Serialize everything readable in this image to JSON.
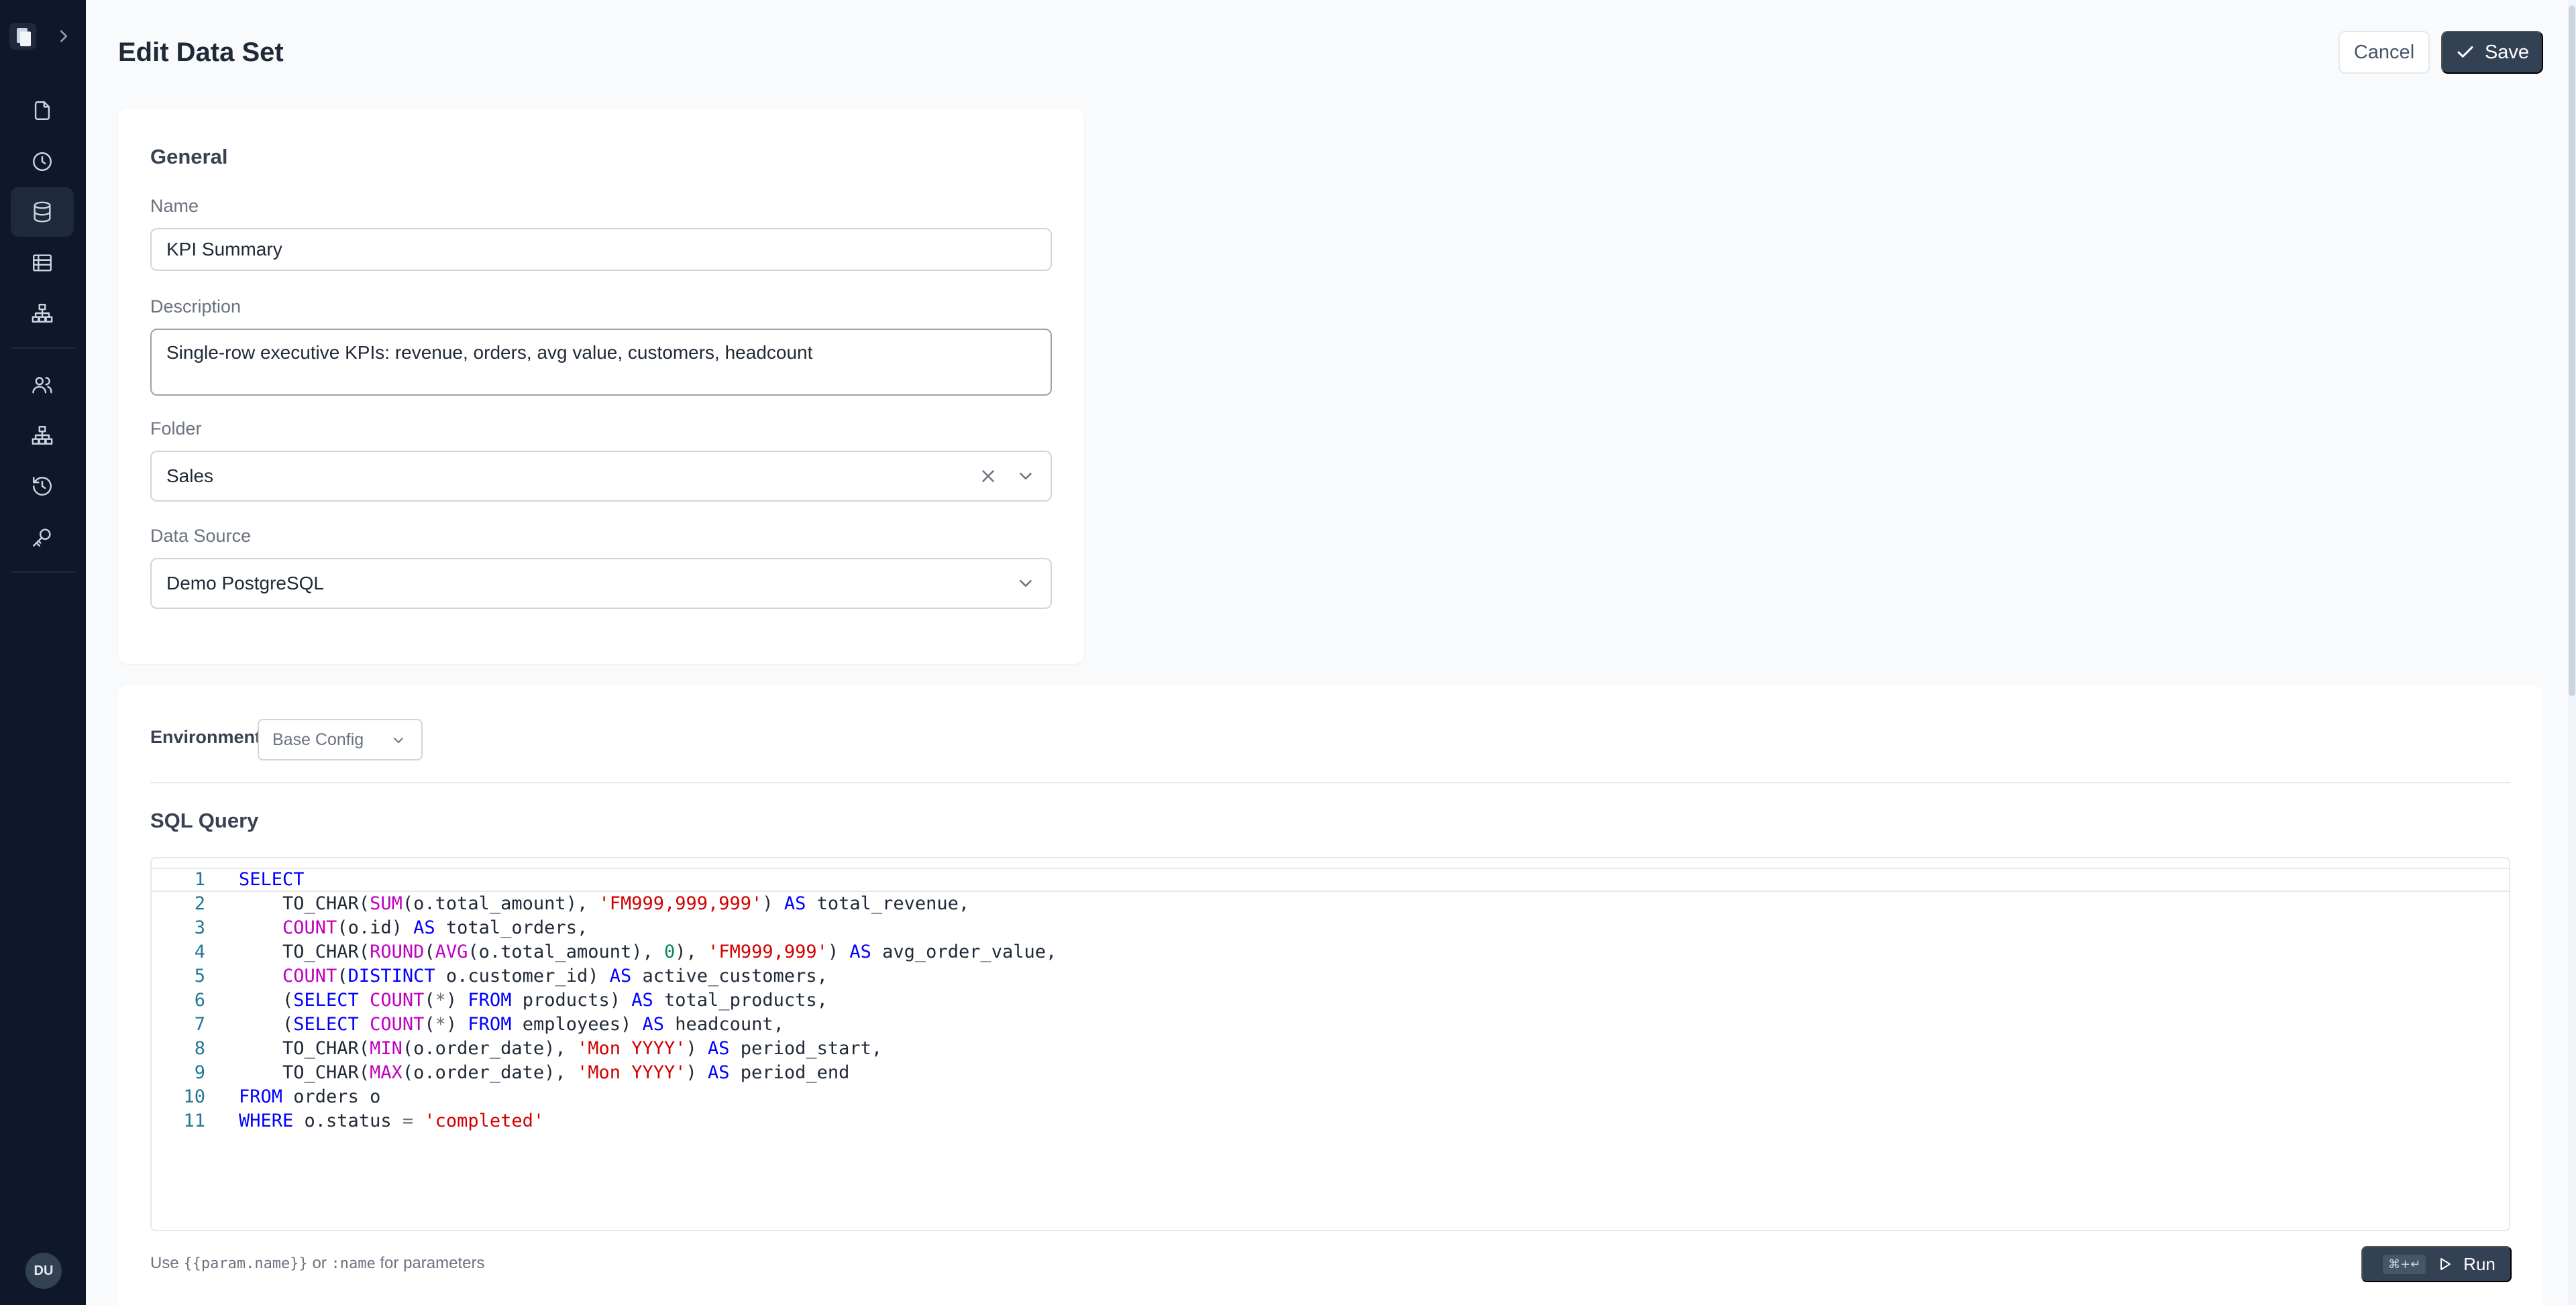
{
  "sidebar": {
    "nav_items": [
      {
        "name": "documents",
        "icon": "file-icon",
        "active": false
      },
      {
        "name": "history",
        "icon": "clock-icon",
        "active": false
      },
      {
        "name": "data-sets",
        "icon": "database-icon",
        "active": true
      },
      {
        "name": "tables",
        "icon": "table-icon",
        "active": false
      },
      {
        "name": "hierarchy",
        "icon": "sitemap-icon",
        "active": false
      },
      {
        "name": "users",
        "icon": "users-icon",
        "active": false
      },
      {
        "name": "org",
        "icon": "sitemap-icon",
        "active": false
      },
      {
        "name": "audit",
        "icon": "rotate-ccw-icon",
        "active": false
      },
      {
        "name": "keys",
        "icon": "key-icon",
        "active": false
      }
    ],
    "avatar_initials": "DU"
  },
  "header": {
    "title": "Edit Data Set",
    "cancel_label": "Cancel",
    "save_label": "Save"
  },
  "general": {
    "title": "General",
    "name_label": "Name",
    "name_value": "KPI Summary",
    "description_label": "Description",
    "description_value": "Single-row executive KPIs: revenue, orders, avg value, customers, headcount",
    "folder_label": "Folder",
    "folder_value": "Sales",
    "datasource_label": "Data Source",
    "datasource_value": "Demo PostgreSQL"
  },
  "query": {
    "environment_label": "Environment",
    "environment_value": "Base Config",
    "title": "SQL Query",
    "line_numbers": [
      "1",
      "2",
      "3",
      "4",
      "5",
      "6",
      "7",
      "8",
      "9",
      "10",
      "11"
    ],
    "lines": [
      "SELECT",
      "    TO_CHAR(SUM(o.total_amount), 'FM999,999,999') AS total_revenue,",
      "    COUNT(o.id) AS total_orders,",
      "    TO_CHAR(ROUND(AVG(o.total_amount), 0), 'FM999,999') AS avg_order_value,",
      "    COUNT(DISTINCT o.customer_id) AS active_customers,",
      "    (SELECT COUNT(*) FROM products) AS total_products,",
      "    (SELECT COUNT(*) FROM employees) AS headcount,",
      "    TO_CHAR(MIN(o.order_date), 'Mon YYYY') AS period_start,",
      "    TO_CHAR(MAX(o.order_date), 'Mon YYYY') AS period_end",
      "FROM orders o",
      "WHERE o.status = 'completed'"
    ],
    "hint_prefix": "Use",
    "hint_param": "{{param.name}}",
    "hint_or": "or",
    "hint_colon": ":name",
    "hint_suffix": "for parameters",
    "run_shortcut": "⌘+↵",
    "run_label": "Run"
  },
  "colors": {
    "sidebar_bg": "#0f172a",
    "primary_button": "#334155",
    "keyword": "#0000ff",
    "function": "#c000c0",
    "string": "#d20000",
    "number": "#098658"
  }
}
